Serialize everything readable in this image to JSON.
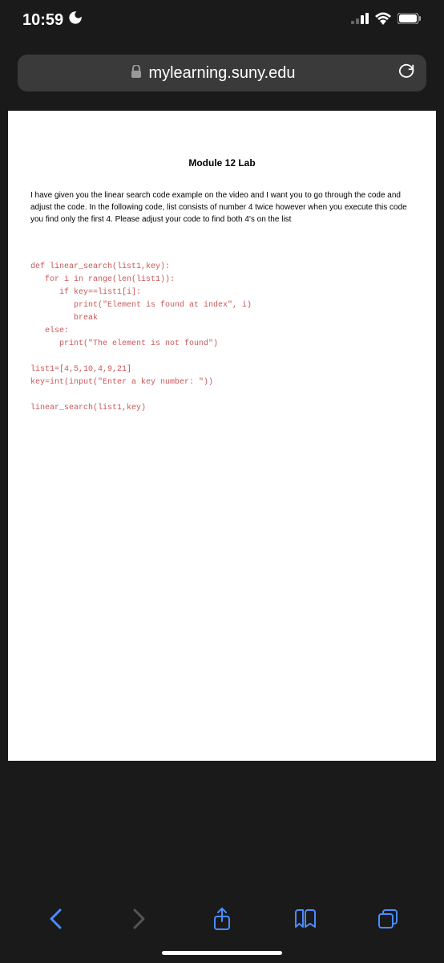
{
  "status": {
    "time": "10:59"
  },
  "address": {
    "url": "mylearning.suny.edu"
  },
  "document": {
    "title": "Module 12 Lab",
    "intro": "I have given you the linear search code example on the video and I want you to go through the code and adjust the code. In the following code, list consists of number 4 twice however when you execute this code you find only the first 4. Please adjust your code to find both 4's on the list",
    "code": {
      "l1": "def linear_search(list1,key):",
      "l2": "   for i in range(len(list1)):",
      "l3": "      if key==list1[i]:",
      "l4": "         print(\"Element is found at index\", i)",
      "l5": "         break",
      "l6": "   else:",
      "l7": "      print(\"The element is not found\")",
      "l8": "list1=[4,5,10,4,9,21]",
      "l9": "key=int(input(\"Enter a key number: \"))",
      "l10": "linear_search(list1,key)"
    }
  }
}
